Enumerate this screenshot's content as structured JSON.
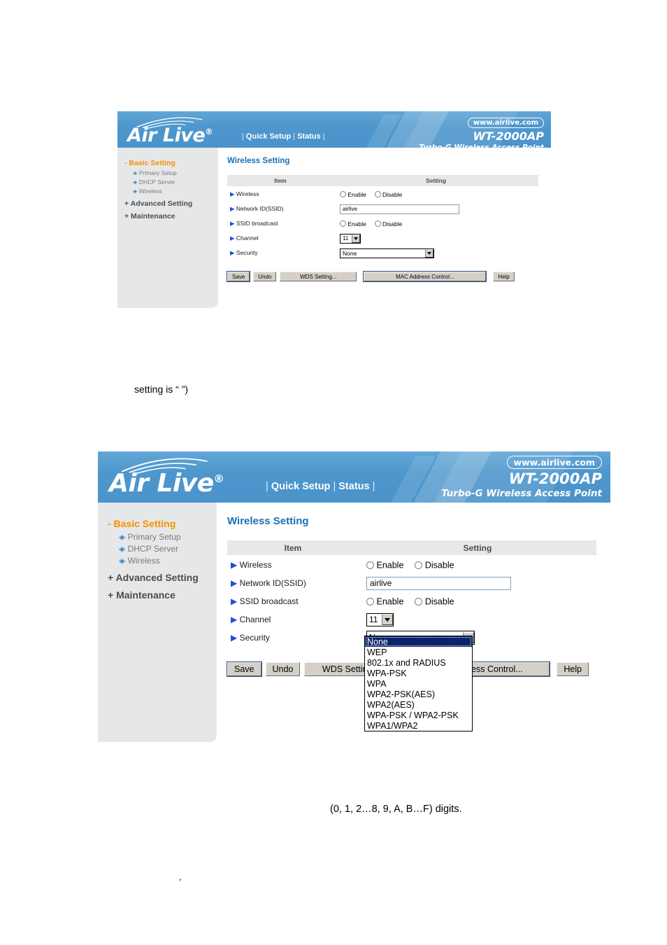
{
  "device": {
    "logo_text": "Air Live",
    "logo_registered": "®",
    "url_badge": "www.airlive.com",
    "model": "WT-2000AP",
    "tagline": "Turbo-G Wireless Access Point",
    "nav": [
      {
        "label": "Quick Setup"
      },
      {
        "label": "Status"
      }
    ],
    "nav_separator": "|"
  },
  "sidebar": {
    "groups": [
      {
        "label": "- Basic Setting",
        "expanded": true,
        "items": [
          {
            "label": "Primary Setup",
            "icon": "diamond-bullet-icon"
          },
          {
            "label": "DHCP Server",
            "icon": "diamond-bullet-icon"
          },
          {
            "label": "Wireless",
            "icon": "diamond-bullet-icon"
          }
        ]
      },
      {
        "label": "+ Advanced Setting",
        "expanded": false,
        "items": []
      },
      {
        "label": "+ Maintenance",
        "expanded": false,
        "items": []
      }
    ]
  },
  "page": {
    "title": "Wireless Setting",
    "columns": {
      "item": "Item",
      "setting": "Setting"
    },
    "rows": [
      {
        "label": "Wireless",
        "control": "radio",
        "options": [
          "Enable",
          "Disable"
        ],
        "value": "Enable"
      },
      {
        "label": "Network ID(SSID)",
        "control": "text",
        "value": "airlive"
      },
      {
        "label": "SSID broadcast",
        "control": "radio",
        "options": [
          "Enable",
          "Disable"
        ],
        "value": "Enable"
      },
      {
        "label": "Channel",
        "control": "select",
        "value": "11"
      },
      {
        "label": "Security",
        "control": "select",
        "value": "None"
      }
    ],
    "buttons": [
      {
        "label": "Save",
        "name": "save-button",
        "focused": true
      },
      {
        "label": "Undo",
        "name": "undo-button",
        "focused": false
      },
      {
        "label": "WDS Setting...",
        "name": "wds-setting-button",
        "focused": false
      },
      {
        "label": "MAC Address Control...",
        "name": "mac-address-control-button",
        "focused": true
      },
      {
        "label": "Help",
        "name": "help-button",
        "focused": false
      }
    ],
    "security_options": [
      "None",
      "WEP",
      "802.1x and RADIUS",
      "WPA-PSK",
      "WPA",
      "WPA2-PSK(AES)",
      "WPA2(AES)",
      "WPA-PSK / WPA2-PSK",
      "WPA1/WPA2"
    ],
    "security_selected": "None"
  },
  "prose": {
    "line1": "setting is “          ”)",
    "line2": "(0, 1, 2…8, 9, A, B…F) digits.",
    "line3": ","
  },
  "colors": {
    "banner_blue": "#4e97cd",
    "title_blue": "#1a6fb5",
    "sidebar_bg": "#e6e7e8",
    "group_orange": "#f39200",
    "table_header_gray": "#e8e8e8",
    "select_highlight": "#0a246a"
  }
}
